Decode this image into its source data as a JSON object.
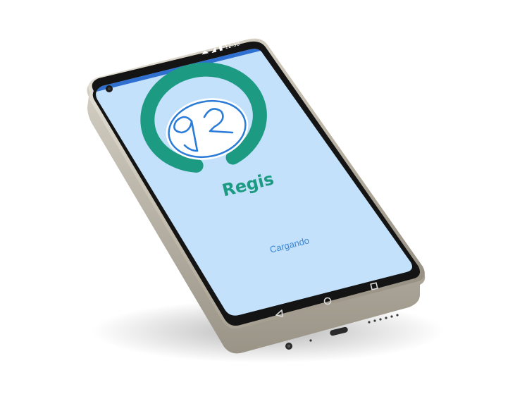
{
  "status_bar": {
    "time": "12:30",
    "icons": [
      "wifi-icon",
      "signal-icon",
      "battery-icon"
    ],
    "color": "#2f6fd0"
  },
  "app": {
    "name": "Regis",
    "loading_label": "Cargando",
    "logo_monogram": "GR"
  },
  "nav_bar": {
    "buttons": [
      "back-icon",
      "home-icon",
      "recents-icon"
    ]
  },
  "colors": {
    "screen_background": "#c3e1fa",
    "brand_teal": "#1d9a82",
    "logo_blue": "#2b7bd8",
    "loading_text": "#3b86d6",
    "bezel": "#151515",
    "frame": "#c9c3b6"
  }
}
